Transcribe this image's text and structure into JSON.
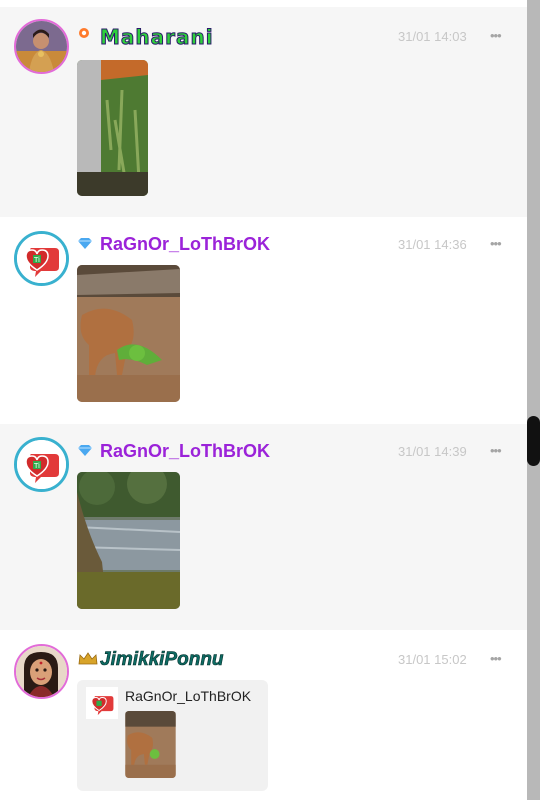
{
  "posts": [
    {
      "username": "Maharani",
      "badge": "fire-badge-icon",
      "time": "31/01 14:03",
      "more": "•••"
    },
    {
      "username": "RaGnOr_LoThBrOK",
      "badge": "diamond-badge-icon",
      "time": "31/01 14:36",
      "more": "•••"
    },
    {
      "username": "RaGnOr_LoThBrOK",
      "badge": "diamond-badge-icon",
      "time": "31/01 14:39",
      "more": "•••"
    },
    {
      "username": "JimikkiPonnu",
      "badge": "crown-badge-icon",
      "time": "31/01 15:02",
      "more": "•••",
      "quoted": {
        "username": "RaGnOr_LoThBrOK"
      }
    }
  ],
  "colors": {
    "purple_name": "#9b23d9",
    "teal_name": "#0d6b63",
    "timestamp": "#c7c7c7",
    "gray_bg": "#f6f6f6"
  },
  "scrollbar": {
    "position": 0.52
  }
}
